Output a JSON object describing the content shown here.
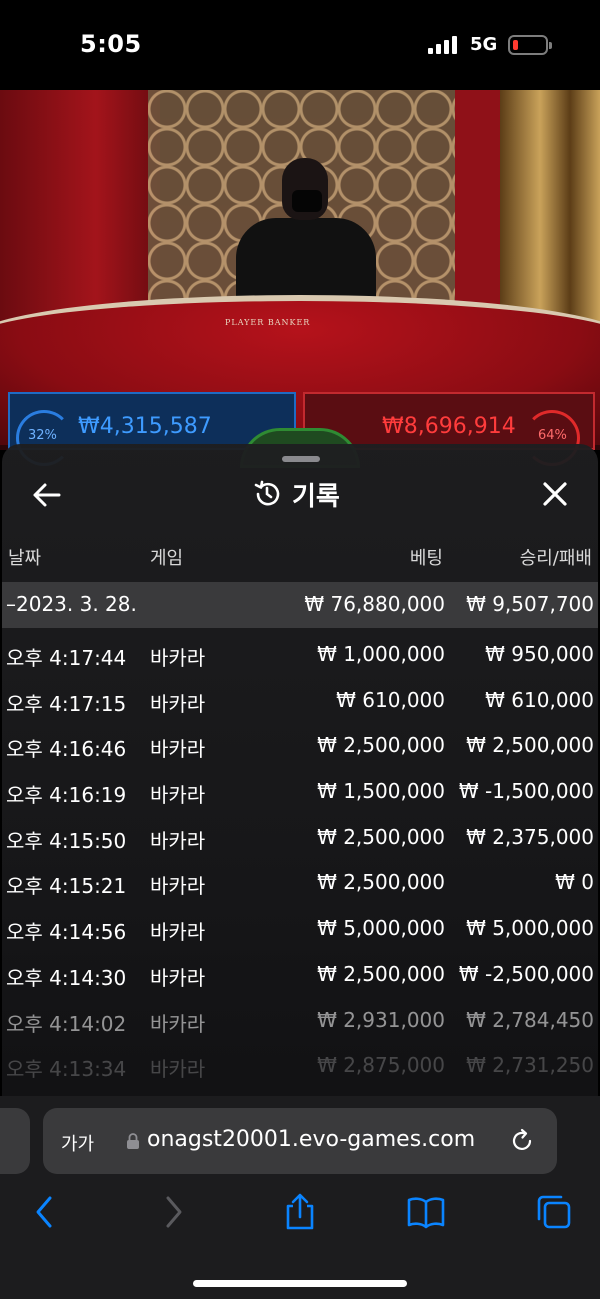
{
  "status": {
    "time": "5:05",
    "network": "5G"
  },
  "video": {
    "table_text": "PLAYER  BANKER",
    "player_total": "₩4,315,587",
    "player_pct": "32%",
    "banker_total": "₩8,696,914",
    "banker_pct": "64%"
  },
  "history": {
    "title": "기록",
    "columns": {
      "date": "날짜",
      "game": "게임",
      "bet": "베팅",
      "result": "승리/패배"
    },
    "summary": {
      "date": "–2023. 3. 28.",
      "bet": "₩ 76,880,000",
      "result": "₩ 9,507,700"
    },
    "rows": [
      {
        "time": "오후 4:17:44",
        "game": "바카라",
        "bet": "₩ 1,000,000",
        "result": "₩ 950,000"
      },
      {
        "time": "오후 4:17:15",
        "game": "바카라",
        "bet": "₩ 610,000",
        "result": "₩ 610,000"
      },
      {
        "time": "오후 4:16:46",
        "game": "바카라",
        "bet": "₩ 2,500,000",
        "result": "₩ 2,500,000"
      },
      {
        "time": "오후 4:16:19",
        "game": "바카라",
        "bet": "₩ 1,500,000",
        "result": "₩ -1,500,000"
      },
      {
        "time": "오후 4:15:50",
        "game": "바카라",
        "bet": "₩ 2,500,000",
        "result": "₩ 2,375,000"
      },
      {
        "time": "오후 4:15:21",
        "game": "바카라",
        "bet": "₩ 2,500,000",
        "result": "₩ 0"
      },
      {
        "time": "오후 4:14:56",
        "game": "바카라",
        "bet": "₩ 5,000,000",
        "result": "₩ 5,000,000"
      },
      {
        "time": "오후 4:14:30",
        "game": "바카라",
        "bet": "₩ 2,500,000",
        "result": "₩ -2,500,000"
      },
      {
        "time": "오후 4:14:02",
        "game": "바카라",
        "bet": "₩ 2,931,000",
        "result": "₩ 2,784,450"
      },
      {
        "time": "오후 4:13:34",
        "game": "바카라",
        "bet": "₩ 2,875,000",
        "result": "₩ 2,731,250"
      }
    ]
  },
  "browser": {
    "aa_label": "가가",
    "url": "onagst20001.evo-games.com"
  },
  "icons": {
    "back": "arrow-left-icon",
    "history": "history-clock-icon",
    "close": "close-icon",
    "lock": "lock-icon",
    "reload": "reload-icon",
    "nav_back": "chevron-left-icon",
    "nav_forward": "chevron-right-icon",
    "share": "share-icon",
    "bookmarks": "book-icon",
    "tabs": "tabs-icon"
  },
  "colors": {
    "ios_blue": "#0a84ff",
    "battery_low": "#ff3b30",
    "player_blue": "#3e9bff",
    "banker_red": "#ff3c3c"
  }
}
